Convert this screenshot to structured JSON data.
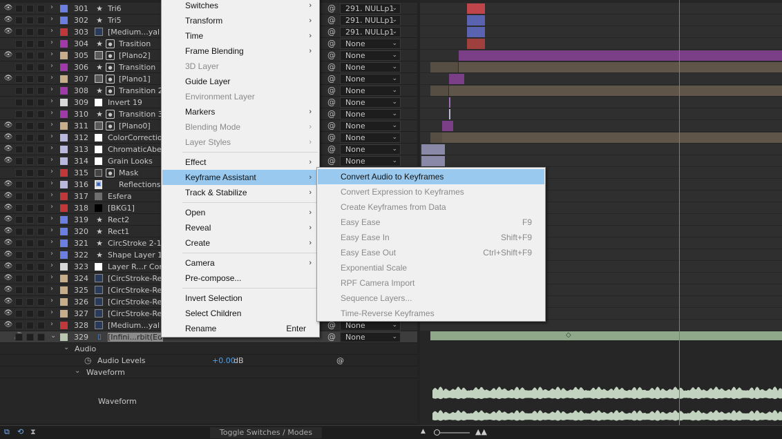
{
  "layers": [
    {
      "eye": true,
      "num": "301",
      "color": "#6b7fe0",
      "type": "star",
      "name": "Tri6",
      "parent": "291. NULLp1"
    },
    {
      "eye": true,
      "num": "302",
      "color": "#6b7fe0",
      "type": "star",
      "name": "Tri5",
      "parent": "291. NULLp1"
    },
    {
      "eye": true,
      "num": "303",
      "color": "#c0383a",
      "type": "comp",
      "name": "[Medium...yal B",
      "parent": "291. NULLp1"
    },
    {
      "eye": false,
      "num": "304",
      "color": "#a03aa8",
      "type": "star2",
      "name": "Trasition",
      "parent": "None"
    },
    {
      "eye": true,
      "num": "305",
      "color": "#c8ad8a",
      "type": "img2",
      "name": "[Plano2]",
      "parent": "None"
    },
    {
      "eye": false,
      "num": "306",
      "color": "#a03aa8",
      "type": "star2",
      "name": "Transition",
      "parent": "None"
    },
    {
      "eye": true,
      "num": "307",
      "color": "#c8ad8a",
      "type": "img2",
      "name": "[Plano1]",
      "parent": "None"
    },
    {
      "eye": false,
      "num": "308",
      "color": "#a03aa8",
      "type": "star2",
      "name": "Transition 2",
      "parent": "None"
    },
    {
      "eye": false,
      "num": "309",
      "color": "#d8d8d8",
      "type": "solid",
      "name": "Invert 19",
      "parent": "None"
    },
    {
      "eye": false,
      "num": "310",
      "color": "#a03aa8",
      "type": "star2",
      "name": "Transition 3",
      "parent": "None"
    },
    {
      "eye": true,
      "num": "311",
      "color": "#c8ad8a",
      "type": "img2",
      "name": "[Plano0]",
      "parent": "None"
    },
    {
      "eye": true,
      "num": "312",
      "color": "#b9b9e0",
      "type": "solid",
      "name": "ColorCorrection",
      "parent": "None"
    },
    {
      "eye": true,
      "num": "313",
      "color": "#b9b9e0",
      "type": "solid",
      "name": "ChromaticAberration",
      "parent": "None"
    },
    {
      "eye": true,
      "num": "314",
      "color": "#b9b9e0",
      "type": "solid",
      "name": "Grain Looks",
      "parent": "None"
    },
    {
      "eye": false,
      "num": "315",
      "color": "#c0383a",
      "type": "mask",
      "name": "Mask",
      "parent": ""
    },
    {
      "eye": true,
      "num": "316",
      "color": "#b9b9e0",
      "type": "file",
      "name": "Reflections",
      "parent": ""
    },
    {
      "eye": true,
      "num": "317",
      "color": "#c0383a",
      "type": "grey",
      "name": "Esfera",
      "parent": ""
    },
    {
      "eye": true,
      "num": "318",
      "color": "#c0383a",
      "type": "black",
      "name": "[BKG1]",
      "parent": ""
    },
    {
      "eye": true,
      "num": "319",
      "color": "#6b7fe0",
      "type": "star",
      "name": "Rect2",
      "parent": ""
    },
    {
      "eye": true,
      "num": "320",
      "color": "#6b7fe0",
      "type": "star",
      "name": "Rect1",
      "parent": ""
    },
    {
      "eye": true,
      "num": "321",
      "color": "#6b7fe0",
      "type": "star",
      "name": "CircStroke 2-1",
      "parent": ""
    },
    {
      "eye": true,
      "num": "322",
      "color": "#6b7fe0",
      "type": "star",
      "name": "Shape Layer 1",
      "parent": ""
    },
    {
      "eye": true,
      "num": "323",
      "color": "#d8d8d8",
      "type": "solid",
      "name": "Layer R...r Controls",
      "parent": ""
    },
    {
      "eye": true,
      "num": "324",
      "color": "#c8ad8a",
      "type": "comp",
      "name": "[CircStroke-Repeater]",
      "parent": ""
    },
    {
      "eye": true,
      "num": "325",
      "color": "#c8ad8a",
      "type": "comp",
      "name": "[CircStroke-Repeater]",
      "parent": ""
    },
    {
      "eye": true,
      "num": "326",
      "color": "#c8ad8a",
      "type": "comp",
      "name": "[CircStroke-Repeater]",
      "parent": ""
    },
    {
      "eye": true,
      "num": "327",
      "color": "#c8ad8a",
      "type": "comp",
      "name": "[CircStroke-Repeater]",
      "parent": ""
    },
    {
      "eye": true,
      "num": "328",
      "color": "#c0383a",
      "type": "comp",
      "name": "[Medium...yal B",
      "parent": "None"
    },
    {
      "eye": false,
      "num": "329",
      "color": "#b7c8ae",
      "type": "audio",
      "name": "[Infini...rbit(Edited).mp3]",
      "parent": "None"
    }
  ],
  "sub": {
    "audio": "Audio",
    "audio_levels": "Audio Levels",
    "audio_levels_value": "+0.00",
    "audio_levels_unit": "dB",
    "waveform_group": "Waveform",
    "waveform": "Waveform"
  },
  "context_menu": {
    "items": [
      {
        "label": "Switches",
        "chev": true,
        "dis": false
      },
      {
        "label": "Transform",
        "chev": true,
        "dis": false
      },
      {
        "label": "Time",
        "chev": true,
        "dis": false
      },
      {
        "label": "Frame Blending",
        "chev": true,
        "dis": false
      },
      {
        "label": "3D Layer",
        "chev": false,
        "dis": true
      },
      {
        "label": "Guide Layer",
        "chev": false,
        "dis": false
      },
      {
        "label": "Environment Layer",
        "chev": false,
        "dis": true
      },
      {
        "label": "Markers",
        "chev": true,
        "dis": false
      },
      {
        "label": "Blending Mode",
        "chev": true,
        "dis": true
      },
      {
        "label": "Layer Styles",
        "chev": true,
        "dis": true
      },
      {
        "label": "Effect",
        "chev": true,
        "dis": false
      },
      {
        "label": "Keyframe Assistant",
        "chev": true,
        "dis": false,
        "hl": true
      },
      {
        "label": "Track & Stabilize",
        "chev": true,
        "dis": false
      },
      {
        "label": "Open",
        "chev": true,
        "dis": false
      },
      {
        "label": "Reveal",
        "chev": true,
        "dis": false
      },
      {
        "label": "Create",
        "chev": true,
        "dis": false
      },
      {
        "label": "Camera",
        "chev": true,
        "dis": false
      },
      {
        "label": "Pre-compose...",
        "chev": false,
        "dis": false
      },
      {
        "label": "Invert Selection",
        "chev": false,
        "dis": false
      },
      {
        "label": "Select Children",
        "chev": false,
        "dis": false
      },
      {
        "label": "Rename",
        "chev": false,
        "dis": false,
        "shortcut": "Enter"
      }
    ]
  },
  "submenu": {
    "items": [
      {
        "label": "Convert Audio to Keyframes",
        "dis": false,
        "hl": true
      },
      {
        "label": "Convert Expression to Keyframes",
        "dis": true
      },
      {
        "label": "Create Keyframes from Data",
        "dis": true
      },
      {
        "label": "Easy Ease",
        "dis": true,
        "shortcut": "F9"
      },
      {
        "label": "Easy Ease In",
        "dis": true,
        "shortcut": "Shift+F9"
      },
      {
        "label": "Easy Ease Out",
        "dis": true,
        "shortcut": "Ctrl+Shift+F9"
      },
      {
        "label": "Exponential Scale",
        "dis": true
      },
      {
        "label": "RPF Camera Import",
        "dis": true
      },
      {
        "label": "Sequence Layers...",
        "dis": true
      },
      {
        "label": "Time-Reverse Keyframes",
        "dis": true
      }
    ]
  },
  "bottom": {
    "toggle_label": "Toggle Switches / Modes"
  },
  "colors": {
    "menu_highlight": "#99c9ef",
    "playhead": "#3c8fe0",
    "waveform": "#c2d3c0"
  }
}
